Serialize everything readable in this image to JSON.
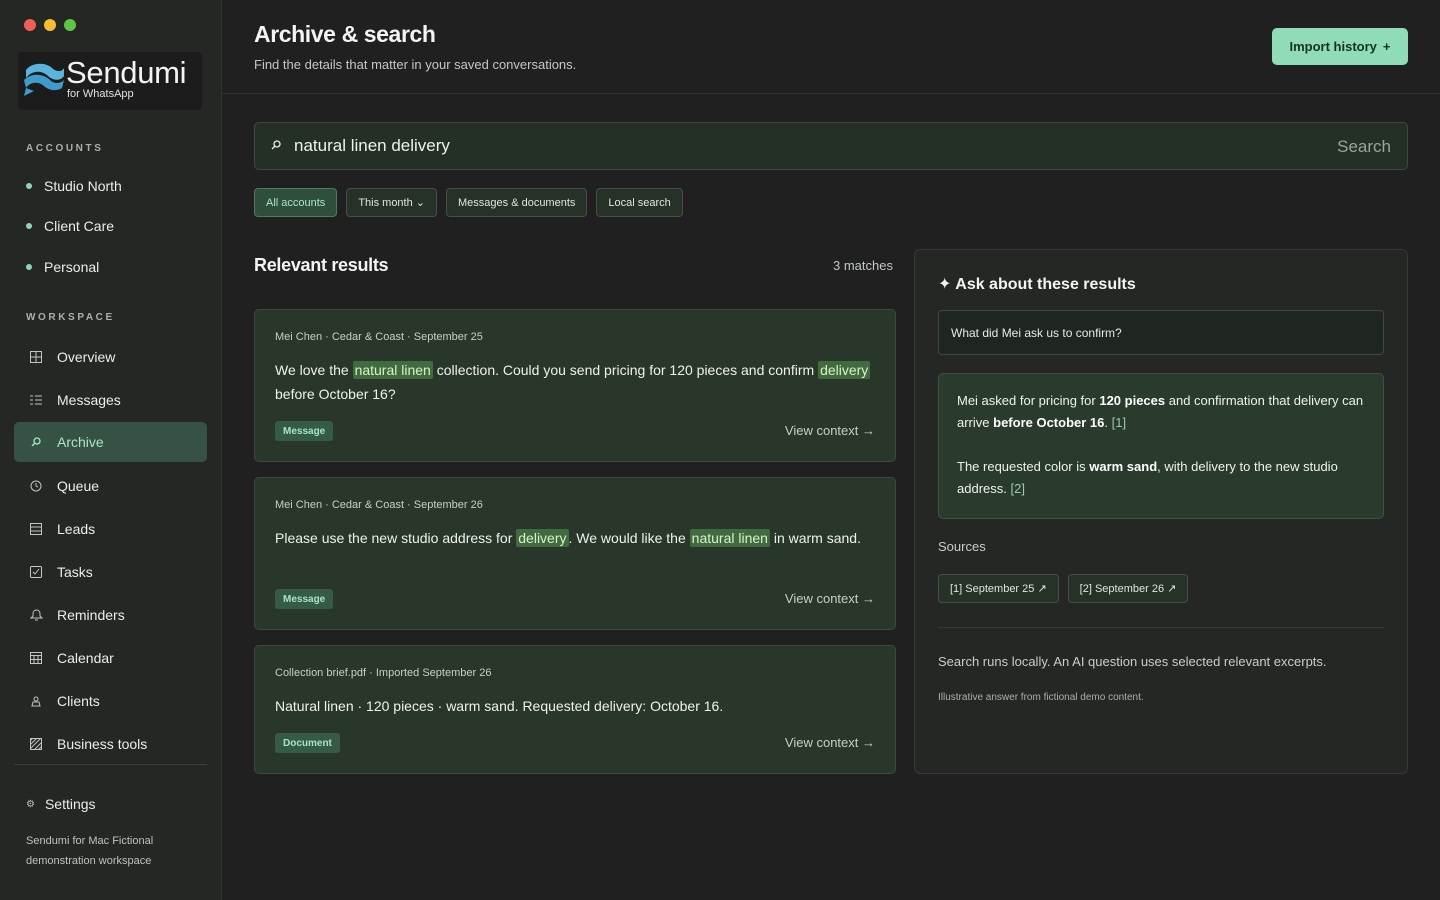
{
  "app": {
    "name": "Sendumi",
    "subtitle": "for WhatsApp"
  },
  "sidebar": {
    "accounts_label": "ACCOUNTS",
    "accounts": [
      {
        "label": "Studio North"
      },
      {
        "label": "Client Care"
      },
      {
        "label": "Personal"
      }
    ],
    "workspace_label": "WORKSPACE",
    "nav": [
      {
        "label": "Overview",
        "icon": "grid-icon"
      },
      {
        "label": "Messages",
        "icon": "list-icon"
      },
      {
        "label": "Archive",
        "icon": "search-icon",
        "active": true
      },
      {
        "label": "Queue",
        "icon": "clock-icon"
      },
      {
        "label": "Leads",
        "icon": "stack-icon"
      },
      {
        "label": "Tasks",
        "icon": "checkbox-icon"
      },
      {
        "label": "Reminders",
        "icon": "bell-icon"
      },
      {
        "label": "Calendar",
        "icon": "calendar-icon"
      },
      {
        "label": "Clients",
        "icon": "person-icon"
      },
      {
        "label": "Business tools",
        "icon": "tools-icon"
      }
    ],
    "settings_label": "Settings",
    "footnote": "Sendumi for Mac Fictional demonstration workspace"
  },
  "header": {
    "title": "Archive & search",
    "subtitle": "Find the details that matter in your saved conversations.",
    "import_label": "Import history",
    "import_icon_text": "+"
  },
  "search": {
    "value": "natural linen delivery",
    "button_label": "Search"
  },
  "filters": [
    {
      "label": "All accounts",
      "active": true
    },
    {
      "label": "This month ⌄",
      "active": false
    },
    {
      "label": "Messages & documents",
      "active": false
    },
    {
      "label": "Local search",
      "active": false
    }
  ],
  "results": {
    "title": "Relevant results",
    "count": "3 matches",
    "items": [
      {
        "meta": "Mei Chen · Cedar & Coast · September 25",
        "tag": "Message",
        "context_label": "View context →"
      },
      {
        "meta": "Mei Chen · Cedar & Coast · September 26",
        "tag": "Message",
        "context_label": "View context →"
      },
      {
        "meta": "Collection brief.pdf · Imported September 26",
        "body": "Natural linen · 120 pieces · warm sand. Requested delivery: October 16.",
        "tag": "Document",
        "context_label": "View context →"
      }
    ],
    "text_parts": {
      "r1_a": "We love the ",
      "r1_mark1": "natural linen",
      "r1_b": " collection. Could you send pricing for 120 pieces and confirm ",
      "r1_mark2": "delivery",
      "r1_c": " before October 16?",
      "r2_a": "Please use the new studio address for ",
      "r2_mark1": "delivery",
      "r2_b": ". We would like the ",
      "r2_mark2": "natural linen",
      "r2_c": " in warm sand."
    }
  },
  "ask": {
    "title": "✦ Ask about these results",
    "question": "What did Mei ask us to confirm?",
    "answer": {
      "p1_a": "Mei asked for pricing for ",
      "p1_b1": "120 pieces",
      "p1_c": " and confirmation that delivery can arrive ",
      "p1_b2": "before October 16",
      "p1_d": ". ",
      "p1_ref": "[1]",
      "p2_a": "The requested color is ",
      "p2_b": "warm sand",
      "p2_c": ", with delivery to the new studio address. ",
      "p2_ref": "[2]"
    },
    "sources_label": "Sources",
    "sources": [
      {
        "label": "[1] September 25 ↗"
      },
      {
        "label": "[2] September 26 ↗"
      }
    ],
    "note": "Search runs locally. An AI question uses selected relevant excerpts.",
    "small_note": "Illustrative answer from fictional demo content."
  },
  "colors": {
    "accent": "#8fdcb6",
    "active_nav_bg": "#355245",
    "highlight": "#416a3f"
  }
}
